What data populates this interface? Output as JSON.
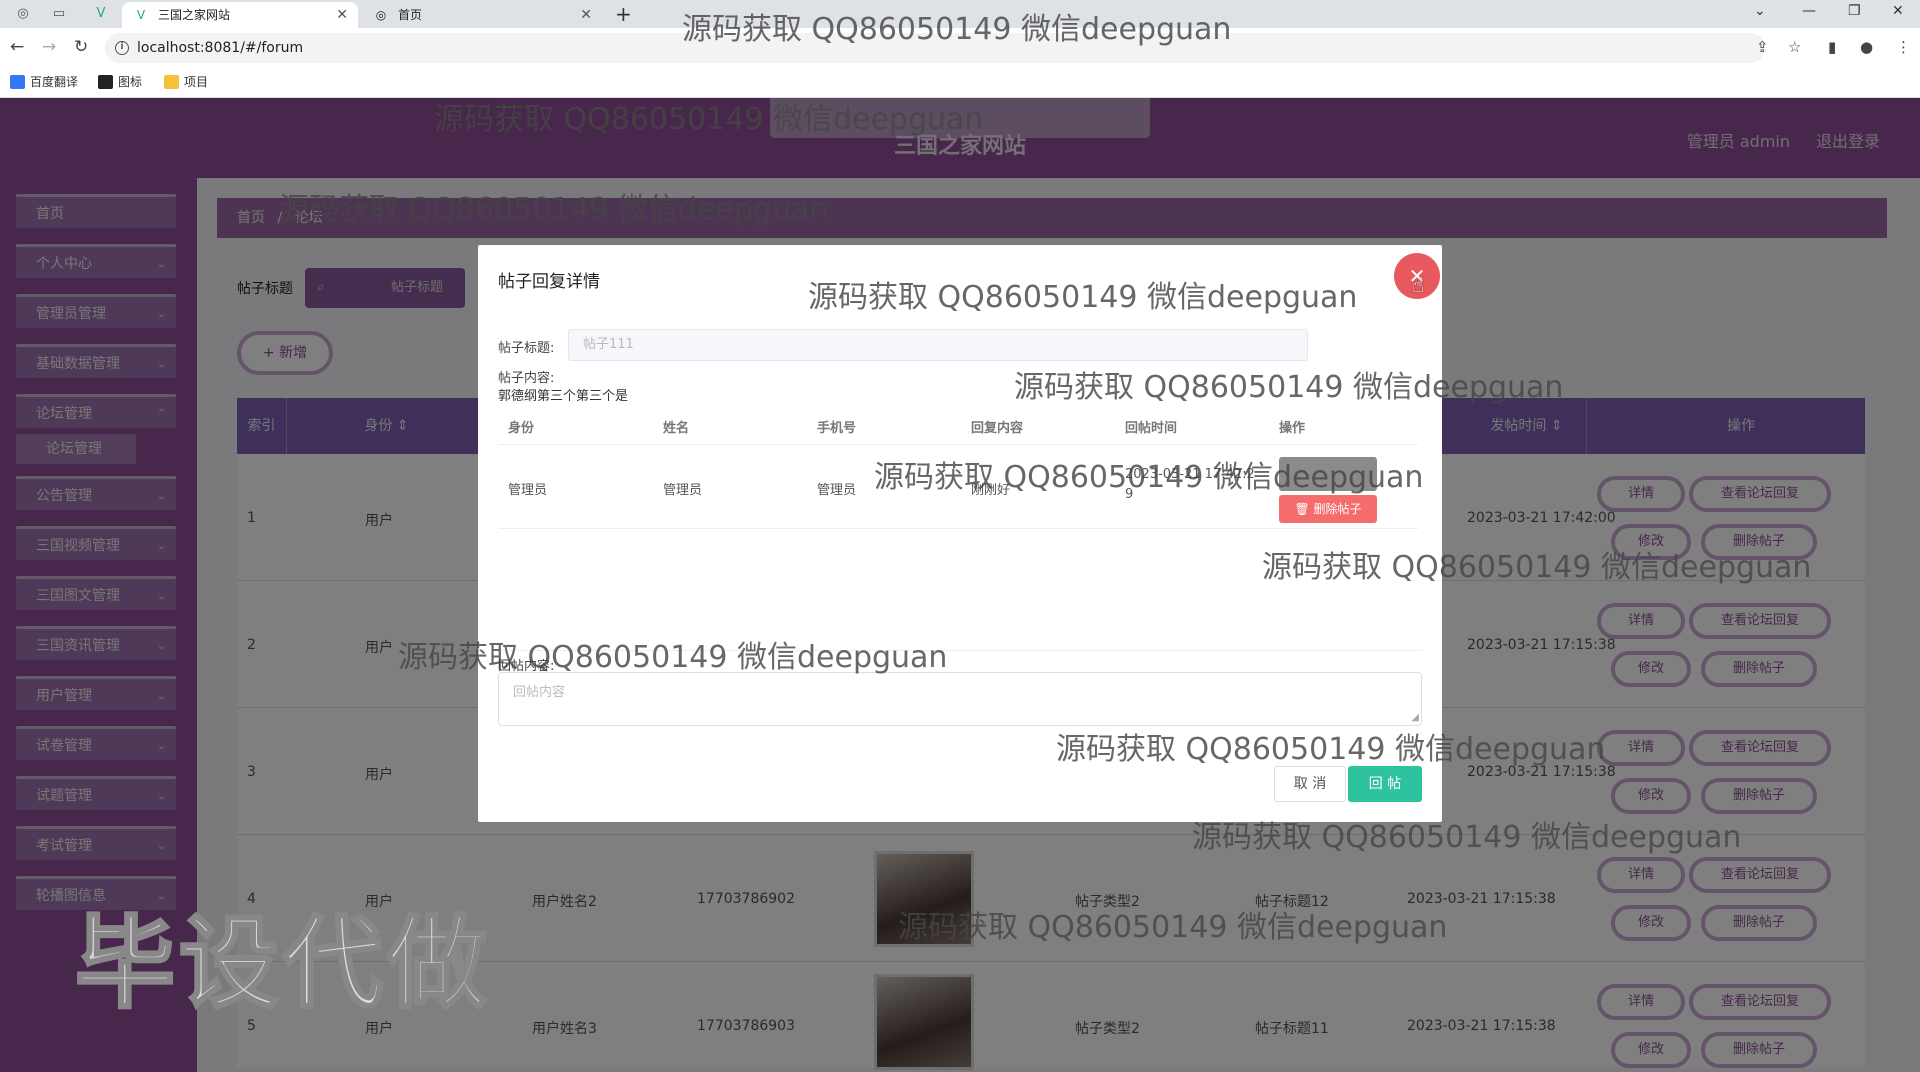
{
  "browser": {
    "tabs": [
      {
        "title": "三国之家网站",
        "active": true
      },
      {
        "title": "首页",
        "active": false
      }
    ],
    "url": "localhost:8081/#/forum",
    "bookmarks": [
      "百度翻译",
      "图标",
      "项目"
    ]
  },
  "header": {
    "site_title": "三国之家网站",
    "admin_label": "管理员 admin",
    "logout_label": "退出登录"
  },
  "sidebar": {
    "items": [
      {
        "label": "首页",
        "has_children": false
      },
      {
        "label": "个人中心",
        "has_children": true
      },
      {
        "label": "管理员管理",
        "has_children": true
      },
      {
        "label": "基础数据管理",
        "has_children": true
      },
      {
        "label": "论坛管理",
        "has_children": true
      },
      {
        "label": "公告管理",
        "has_children": true
      },
      {
        "label": "三国视频管理",
        "has_children": true
      },
      {
        "label": "三国图文管理",
        "has_children": true
      },
      {
        "label": "三国资讯管理",
        "has_children": true
      },
      {
        "label": "用户管理",
        "has_children": true
      },
      {
        "label": "试卷管理",
        "has_children": true
      },
      {
        "label": "试题管理",
        "has_children": true
      },
      {
        "label": "考试管理",
        "has_children": true
      },
      {
        "label": "轮播图信息",
        "has_children": true
      }
    ],
    "active_submenu": "论坛管理"
  },
  "breadcrumb": {
    "home": "首页",
    "separator": "/",
    "current": "论坛"
  },
  "search": {
    "label": "帖子标题",
    "placeholder": "帖子标题"
  },
  "add_button": "+ 新增",
  "table": {
    "headers": [
      "索引",
      "身份",
      "操作",
      "发帖时间"
    ],
    "sort_mark": "⇕",
    "rows": [
      {
        "index": "1",
        "identity": "用户",
        "time": "2023-03-21 17:42:00"
      },
      {
        "index": "2",
        "identity": "用户",
        "time": "2023-03-21 17:15:38"
      },
      {
        "index": "3",
        "identity": "用户",
        "time": "2023-03-21 17:15:38"
      },
      {
        "index": "4",
        "identity": "用户",
        "name": "用户姓名2",
        "phone": "17703786902",
        "type": "帖子类型2",
        "title": "帖子标题12",
        "time": "2023-03-21 17:15:38"
      },
      {
        "index": "5",
        "identity": "用户",
        "name": "用户姓名3",
        "phone": "17703786903",
        "type": "帖子类型2",
        "title": "帖子标题11",
        "time": "2023-03-21 17:15:38"
      }
    ],
    "ops": {
      "detail": "详情",
      "view_reply": "查看论坛回复",
      "edit": "修改",
      "delete": "删除帖子"
    }
  },
  "modal": {
    "title": "帖子回复详情",
    "post_title_label": "帖子标题:",
    "post_title_value": "帖子111",
    "post_content_label": "帖子内容:",
    "post_content_value": "郭德纲第三个第三个是",
    "reply_headers": [
      "身份",
      "姓名",
      "手机号",
      "回复内容",
      "回帖时间",
      "操作"
    ],
    "reply_rows": [
      {
        "identity": "管理员",
        "name": "管理员",
        "phone": "管理员",
        "content": "刚刚好",
        "time_line1": "2023-03-21 17:42:2",
        "time_line2": "9",
        "delete_label": "删除帖子"
      }
    ],
    "reply_label": "回帖内容:",
    "reply_placeholder": "回帖内容",
    "cancel_label": "取 消",
    "submit_label": "回 帖"
  },
  "watermark": {
    "text": "源码获取 QQ86050149 微信deepguan",
    "big_text": "毕设代做"
  }
}
